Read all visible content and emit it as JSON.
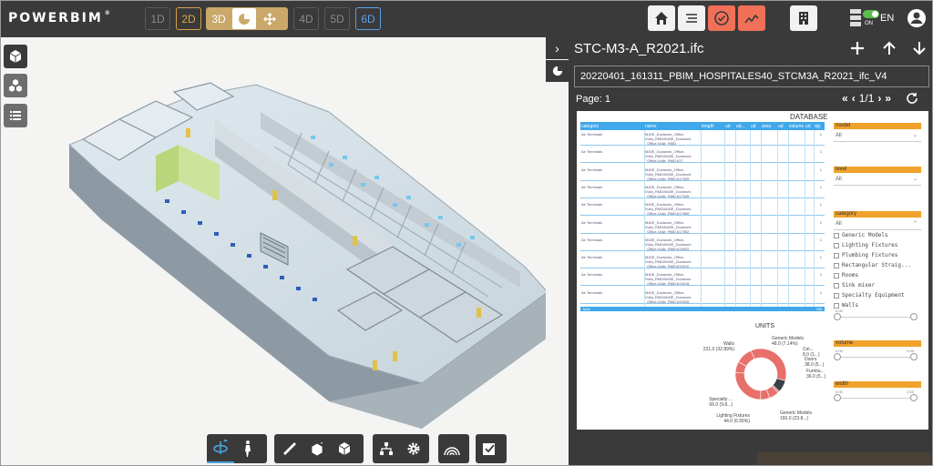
{
  "app": {
    "logo": "POWERBIM"
  },
  "dimensions": {
    "d1": "1D",
    "d2": "2D",
    "d3": "3D",
    "d4": "4D",
    "d5": "5D",
    "d6": "6D"
  },
  "top_icons": [
    "home-icon",
    "list-icon",
    "check-circle-icon",
    "trend-chart-icon",
    "building-icon",
    "server-icon",
    "user-icon"
  ],
  "toggle": {
    "label": "ON"
  },
  "language": "EN",
  "panel": {
    "title": "STC-M3-A_R2021.ifc",
    "file_name": "20220401_161311_PBIM_HOSPITALES40_STCM3A_R2021_ifc_V4",
    "page_label": "Page:",
    "page_number": "1",
    "pager": "1/1"
  },
  "report": {
    "database_title": "DATABASE",
    "columns": [
      "category",
      "name",
      "length",
      "ud",
      "ud...",
      "ud",
      "area",
      "ud",
      "volume",
      "ud",
      "qty"
    ],
    "rows": [
      {
        "category": "Air Terminals",
        "name": "M40E_Ductwork_Office-\nVolla_RMD/M40E_Ductwork\n_Office-Volla_RMD",
        "qty": "1"
      },
      {
        "category": "Air Terminals",
        "name": "M40E_Ductwork_Office-\nVolla_RMD/M40E_Ductwork\n_Office-Volla_RMD:617",
        "qty": "1"
      },
      {
        "category": "Air Terminals",
        "name": "M40E_Ductwork_Office-\nVolla_RMD/M40E_Ductwork\n_Office-Volla_RMD:617639",
        "qty": "1"
      },
      {
        "category": "Air Terminals",
        "name": "M40E_Ductwork_Office-\nVolla_RMD/M40E_Ductwork\n_Office-Volla_RMD:617645",
        "qty": "1"
      },
      {
        "category": "Air Terminals",
        "name": "M40E_Ductwork_Office-\nVolla_RMD/M40E_Ductwork\n_Office-Volla_RMD:617806",
        "qty": "1"
      },
      {
        "category": "Air Terminals",
        "name": "M40E_Ductwork_Office-\nVolla_RMD/M40E_Ductwork\n_Office-Volla_RMD:617992",
        "qty": "1"
      },
      {
        "category": "Air Terminals",
        "name": "M40E_Ductwork_Office-\nVolla_RMD/M40E_Ductwork\n_Office-Volla_RMD:619002",
        "qty": "1"
      },
      {
        "category": "Air Terminals",
        "name": "M40E_Ductwork_Office-\nVolla_RMD/M40E_Ductwork\n_Office-Volla_RMD:619010",
        "qty": "1"
      },
      {
        "category": "Air Terminals",
        "name": "M40E_Ductwork_Office-\nVolla_RMD/M40E_Ductwork\n_Office-Volla_RMD:619018",
        "qty": "1"
      },
      {
        "category": "Air Terminals",
        "name": "M40E_Ductwork_Office-\nVolla_RMD/M40E_Ductwork\n_Office-Volla_RMD:619026",
        "qty": "1"
      }
    ],
    "total_label": "Total",
    "total_value": "765",
    "units_title": "UNITS"
  },
  "chart_data": {
    "type": "pie",
    "title": "UNITS",
    "slices": [
      {
        "label": "Walls",
        "value": 221.0,
        "pct": "32.89%"
      },
      {
        "label": "Generic Models",
        "value": 48.0,
        "pct": "7.14%"
      },
      {
        "label": "Cei...",
        "value": 8.0,
        "pct": "1..."
      },
      {
        "label": "Doors",
        "value": 38.0,
        "pct": "5..."
      },
      {
        "label": "Furnitu...",
        "value": 36.0,
        "pct": "5..."
      },
      {
        "label": "Generic Models",
        "value": 160.0,
        "pct": "23.8..."
      },
      {
        "label": "Lighting Fixtures",
        "value": 44.0,
        "pct": "6.55%"
      },
      {
        "label": "Specialty ...",
        "value": 66.0,
        "pct": "9.8..."
      }
    ],
    "colors": [
      "#e8706a",
      "#3a4148"
    ]
  },
  "filters": {
    "model": {
      "label": "model",
      "value": "All"
    },
    "level": {
      "label": "level",
      "value": "All"
    },
    "category": {
      "label": "category",
      "value": "All",
      "items": [
        "Generic Models",
        "Lighting Fixtures",
        "Plumbing Fixtures",
        "Rectangular Straig...",
        "Rooms",
        "Sink mixer",
        "Specialty Equipment",
        "Walls"
      ]
    },
    "volume": {
      "label": "volume"
    },
    "width": {
      "label": "width"
    },
    "slider_min": "0.00"
  }
}
